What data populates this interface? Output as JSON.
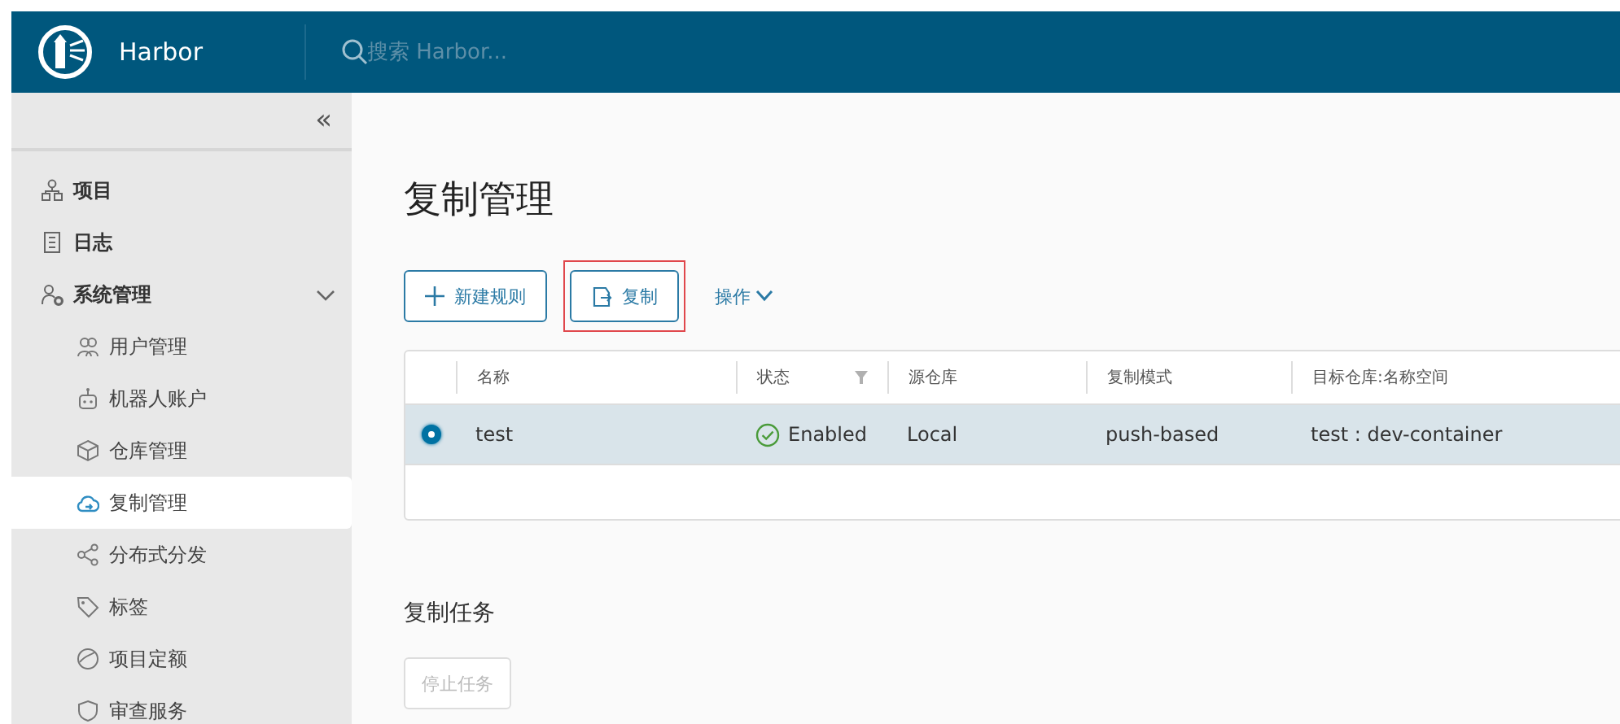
{
  "header": {
    "brand": "Harbor",
    "search": {
      "placeholder": "搜索 Harbor..."
    }
  },
  "sidebar": {
    "collapse": "«",
    "items": [
      {
        "label": "项目",
        "selected": false
      },
      {
        "label": "日志",
        "selected": false
      },
      {
        "label": "系统管理",
        "selected": false,
        "expanded": true,
        "children": [
          {
            "label": "用户管理",
            "selected": false
          },
          {
            "label": "机器人账户",
            "selected": false
          },
          {
            "label": "仓库管理",
            "selected": false
          },
          {
            "label": "复制管理",
            "selected": true
          },
          {
            "label": "分布式分发",
            "selected": false
          },
          {
            "label": "标签",
            "selected": false
          },
          {
            "label": "项目定额",
            "selected": false
          },
          {
            "label": "审查服务",
            "selected": false
          }
        ]
      }
    ]
  },
  "page": {
    "title": "复制管理",
    "toolbar": [
      {
        "kind": "button",
        "label": "新建规则",
        "highlighted": false
      },
      {
        "kind": "button",
        "label": "复制",
        "highlighted": true
      },
      {
        "kind": "dropdown",
        "label": "操作",
        "highlighted": false
      }
    ],
    "table": {
      "columns": [
        {
          "label": "名称",
          "filter": false
        },
        {
          "label": "状态",
          "filter": true
        },
        {
          "label": "源仓库",
          "filter": false
        },
        {
          "label": "复制模式",
          "filter": false
        },
        {
          "label": "目标仓库:名称空间",
          "filter": false
        }
      ],
      "rows": [
        {
          "selected": true,
          "cells": [
            "test",
            "Enabled",
            "Local",
            "push-based",
            "test : dev-container"
          ],
          "status_ok": true
        }
      ]
    },
    "tasks": {
      "title": "复制任务",
      "buttons": [
        {
          "label": "停止任务",
          "disabled": true
        }
      ]
    }
  }
}
